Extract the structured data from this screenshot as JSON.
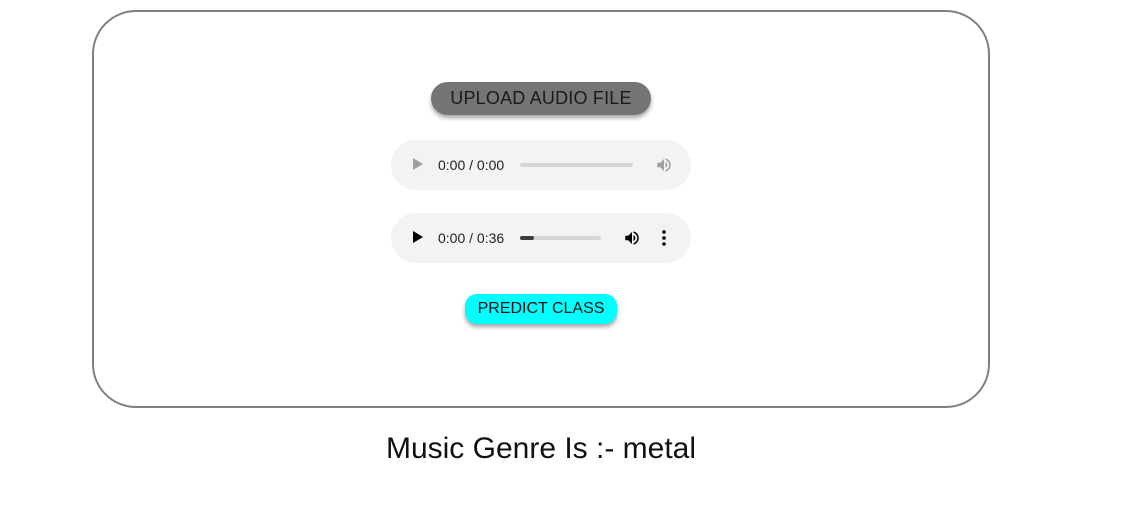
{
  "upload": {
    "label": "UPLOAD AUDIO FILE"
  },
  "players": [
    {
      "time": "0:00 / 0:00",
      "progress": 0,
      "state": "disabled"
    },
    {
      "time": "0:00 / 0:36",
      "progress": 0.15,
      "state": "enabled"
    }
  ],
  "predict": {
    "label": "PREDICT CLASS",
    "color": "#00ffff"
  },
  "result": {
    "text": "Music Genre Is :- metal"
  },
  "icons": {
    "play": "play-icon",
    "volume": "volume-icon",
    "more": "more-vertical-icon"
  }
}
